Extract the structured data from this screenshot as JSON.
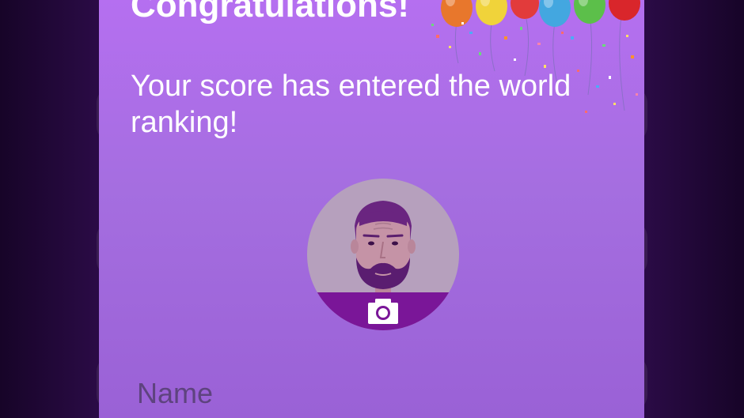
{
  "dialog": {
    "title": "Congratulations!",
    "message": "Your score has entered the world ranking!"
  },
  "avatar": {
    "icon": "bearded-man-avatar",
    "action_icon": "camera-icon"
  },
  "name_field": {
    "value": "",
    "placeholder": "Name"
  },
  "colors": {
    "dialog_top": "#b56ff0",
    "dialog_bottom": "#9a61d6",
    "page_background": "#2a0b45",
    "avatar_circle": "#b6a0bd",
    "avatar_band": "#7a1698"
  }
}
